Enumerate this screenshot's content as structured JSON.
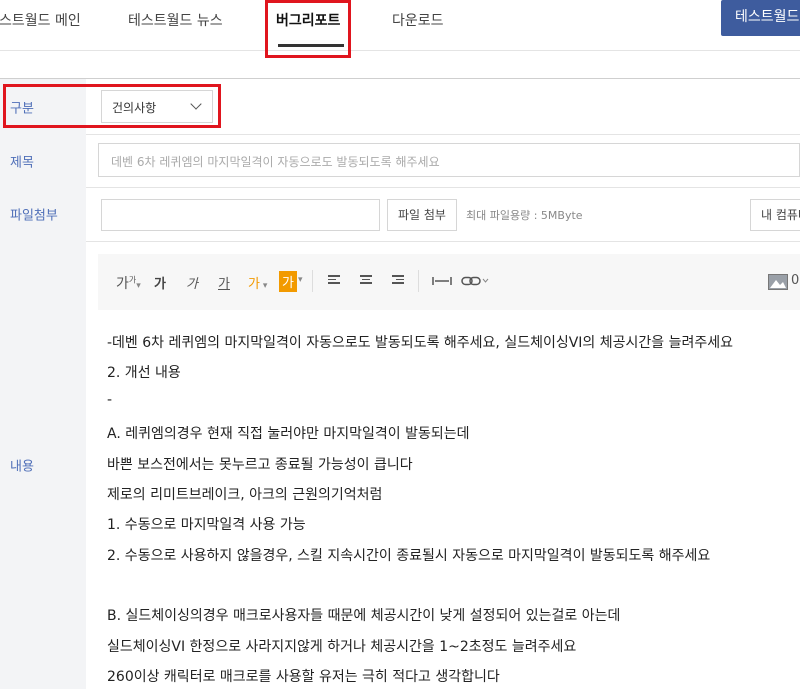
{
  "nav": {
    "tabs": [
      {
        "label": "스트월드 메인"
      },
      {
        "label": "테스트월드 뉴스"
      },
      {
        "label": "버그리포트"
      },
      {
        "label": "다운로드"
      }
    ],
    "cta_label": "테스트월드"
  },
  "form": {
    "category": {
      "label": "구분",
      "value": "건의사항"
    },
    "title": {
      "label": "제목",
      "placeholder": "데벤 6차 레퀴엠의 마지막일격이 자동으로도 발동되도록 해주세요"
    },
    "attachment": {
      "label": "파일첨부",
      "button_label": "파일 첨부",
      "max_size_hint": "최대 파일용량 : 5MByte",
      "pc_button_label": "내 컴퓨터"
    },
    "content": {
      "label": "내용"
    }
  },
  "toolbar": {
    "font_size": "가",
    "font_size_sup": "가",
    "bold": "가",
    "italic": "가",
    "underline": "가",
    "font_color": "가",
    "bg_color": "가",
    "image_label": "0"
  },
  "editor": {
    "lines": [
      "-데벤 6차 레퀴엠의 마지막일격이 자동으로도 발동되도록 해주세요, 실드체이싱VI의 체공시간을 늘려주세요",
      "2. 개선 내용",
      "-",
      "A. 레퀴엠의경우 현재 직접 눌러야만 마지막일격이 발동되는데",
      "바쁜 보스전에서는 못누르고 종료될 가능성이 큽니다",
      "제로의 리미트브레이크, 아크의 근원의기억처럼",
      "1. 수동으로 마지막일격 사용 가능",
      "2. 수동으로 사용하지 않을경우, 스킬 지속시간이 종료될시 자동으로 마지막일격이 발동되도록 해주세요",
      "",
      "B. 실드체이싱의경우 매크로사용자들 때문에 체공시간이 낮게 설정되어 있는걸로 아는데",
      "실드체이싱VI 한정으로 사라지지않게 하거나 체공시간을 1~2초정도 늘려주세요",
      "260이상 캐릭터로 매크로를 사용할 유저는 극히 적다고 생각합니다"
    ]
  }
}
